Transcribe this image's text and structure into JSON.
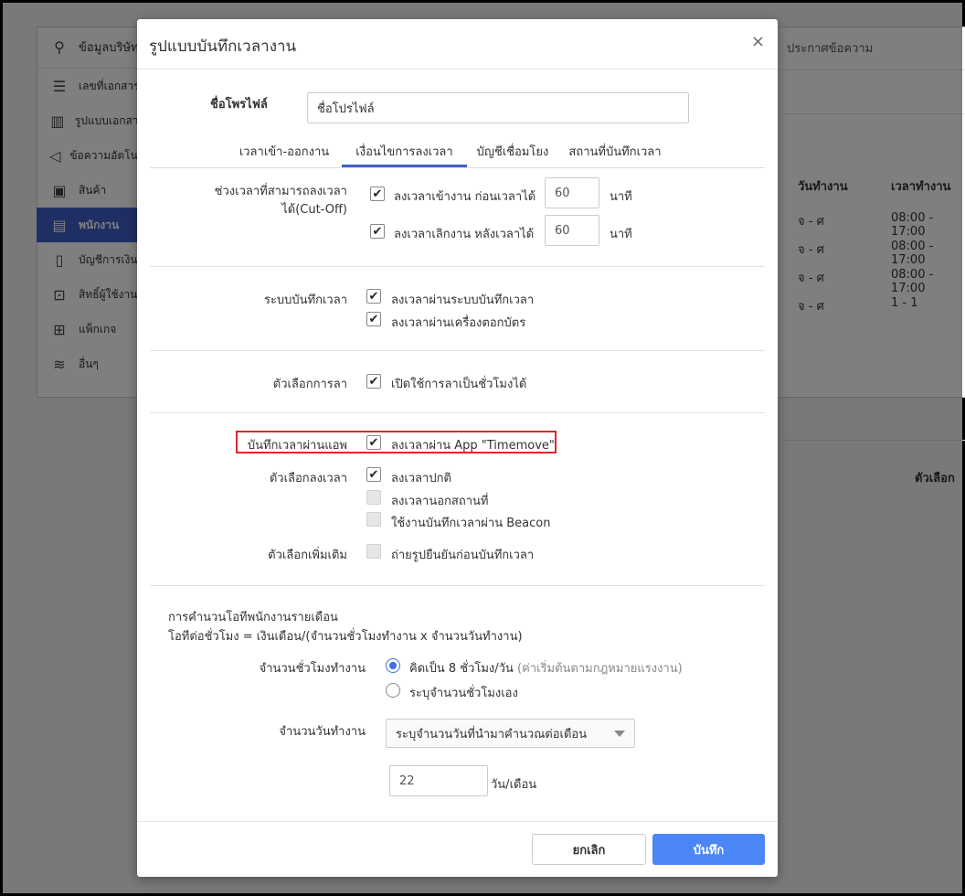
{
  "background": {
    "sidebar": [
      {
        "icon": "signpost-icon",
        "glyph": "⚲",
        "label": "ข้อมูลบริษัท"
      },
      {
        "icon": "list-icon",
        "glyph": "☰",
        "label": "เลขที่เอกสาร"
      },
      {
        "icon": "document-format-icon",
        "glyph": "▥",
        "label": "รูปแบบเอกสาร"
      },
      {
        "icon": "megaphone-icon",
        "glyph": "◁",
        "label": "ข้อความอัตโนมัติ"
      },
      {
        "icon": "box-icon",
        "glyph": "▣",
        "label": "สินค้า"
      },
      {
        "icon": "briefcase-icon",
        "glyph": "▤",
        "label": "พนักงาน"
      },
      {
        "icon": "book-icon",
        "glyph": "▯",
        "label": "บัญชีการเงิน"
      },
      {
        "icon": "lock-icon",
        "glyph": "⊡",
        "label": "สิทธิ์ผู้ใช้งาน"
      },
      {
        "icon": "gift-icon",
        "glyph": "⊞",
        "label": "แพ็กเกจ"
      },
      {
        "icon": "database-icon",
        "glyph": "≋",
        "label": "อื่นๆ"
      }
    ],
    "top_tab": "ประกาศข้อความ",
    "table": {
      "headers": [
        "วันทำงาน",
        "เวลาทำงาน"
      ],
      "rows": [
        [
          "จ - ศ",
          "08:00 - 17:00"
        ],
        [
          "จ - ศ",
          "08:00 - 17:00"
        ],
        [
          "จ - ศ",
          "08:00 - 17:00"
        ],
        [
          "จ - ศ",
          "1 - 1"
        ]
      ]
    },
    "lower_header": "ตัวเลือก"
  },
  "modal": {
    "title": "รูปแบบบันทึกเวลางาน",
    "close_glyph": "×",
    "profile_label": "ชื่อโพรไฟล์",
    "profile_value": "ชื่อโปรไฟล์",
    "tabs": [
      "เวลาเข้า-ออกงาน",
      "เงื่อนไขการลงเวลา",
      "บัญชีเชื่อมโยง",
      "สถานที่บันทึกเวลา"
    ],
    "cutoff": {
      "label_line1": "ช่วงเวลาที่สามารถลงเวลา",
      "label_line2": "ได้(Cut-Off)",
      "check_in_label": "ลงเวลาเข้างาน ก่อนเวลาได้",
      "check_in_value": "60",
      "check_out_label": "ลงเวลาเลิกงาน หลังเวลาได้",
      "check_out_value": "60",
      "unit": "นาที"
    },
    "system": {
      "label": "ระบบบันทึกเวลา",
      "option1": "ลงเวลาผ่านระบบบันทึกเวลา",
      "option2": "ลงเวลาผ่านเครื่องตอกบัตร"
    },
    "leave": {
      "label": "ตัวเลือกการลา",
      "option1": "เปิดใช้การลาเป็นชั่วโมงได้"
    },
    "app": {
      "label": "บันทึกเวลาผ่านแอพ",
      "option1": "ลงเวลาผ่าน App \"Timemove\""
    },
    "clock_options": {
      "label": "ตัวเลือกลงเวลา",
      "option1": "ลงเวลาปกติ",
      "option2": "ลงเวลานอกสถานที่",
      "option3": "ใช้งานบันทึกเวลาผ่าน Beacon"
    },
    "extra": {
      "label": "ตัวเลือกเพิ่มเติม",
      "option1": "ถ่ายรูปยืนยันก่อนบันทึกเวลา"
    },
    "ot": {
      "line1": "การคำนวนโอทีพนักงานรายเดือน",
      "line2": "โอทีต่อชั่วโมง = เงินเดือน/(จำนวนชั่วโมงทำงาน x จำนวนวันทำงาน)",
      "hours_label": "จำนวนชั่วโมงทำงาน",
      "hours_opt1": "คิดเป็น 8 ชั่วโมง/วัน",
      "hours_opt1_note": "(ค่าเริ่มต้นตามกฎหมายแรงงาน)",
      "hours_opt2": "ระบุจำนวนชั่วโมงเอง",
      "days_label": "จำนวนวันทำงาน",
      "days_select": "ระบุจำนวนวันที่นำมาคำนวณต่อเดือน",
      "days_value": "22",
      "days_unit": "วัน/เดือน"
    },
    "footer": {
      "cancel": "ยกเลิก",
      "save": "บันทึก"
    },
    "check_glyph": "✔"
  }
}
